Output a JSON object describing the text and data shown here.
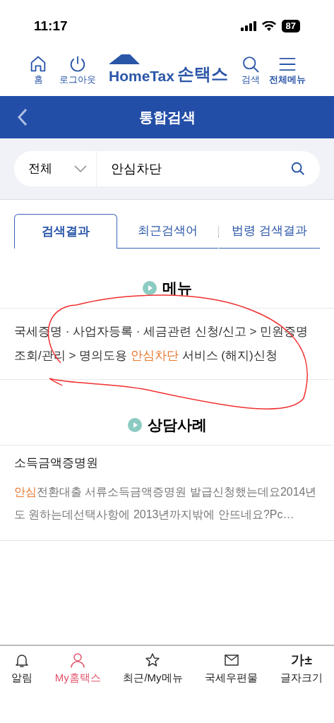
{
  "status_bar": {
    "time": "11:17",
    "battery": "87"
  },
  "header": {
    "left": [
      {
        "kind": "home",
        "label": "홈"
      },
      {
        "kind": "power",
        "label": "로그아웃"
      }
    ],
    "logo": {
      "latin": "HomeTax",
      "korean": "손택스"
    },
    "right": [
      {
        "kind": "search",
        "label": "검색",
        "bold": false
      },
      {
        "kind": "menu",
        "label": "전체메뉴",
        "bold": true
      }
    ]
  },
  "title_bar": {
    "title": "통합검색"
  },
  "search": {
    "category": "전체",
    "value": "안심차단"
  },
  "tabs": [
    {
      "label": "검색결과",
      "selected": true
    },
    {
      "label": "최근검색어",
      "selected": false
    },
    {
      "label": "법령 검색결과",
      "selected": false
    }
  ],
  "sections": [
    {
      "heading": "메뉴",
      "items": [
        {
          "segments": [
            {
              "text": "국세증명 · 사업자등록 · 세금관련 신청/신고 > 민원증명 조회/관리 > 명의도용 ",
              "highlight": false
            },
            {
              "text": "안심차단",
              "highlight": true
            },
            {
              "text": " 서비스 (해지)신청",
              "highlight": false
            }
          ]
        }
      ]
    },
    {
      "heading": "상담사례",
      "items": [
        {
          "title": "소득금액증명원",
          "segments": [
            {
              "text": "안심",
              "highlight": true
            },
            {
              "text": "전환대출 서류소득금액증명원 발급신청했는데요2014년도 원하는데선택사항에 2013년까지밖에 안뜨네요?Pc…",
              "highlight": false
            }
          ]
        }
      ]
    }
  ],
  "bottom_nav": [
    {
      "kind": "bell",
      "label": "알림",
      "selected": false
    },
    {
      "kind": "person",
      "label": "My홈택스",
      "selected": true
    },
    {
      "kind": "star",
      "label": "최근/My메뉴",
      "selected": false
    },
    {
      "kind": "mail",
      "label": "국세우편물",
      "selected": false
    },
    {
      "kind": "text",
      "icon_text": "가±",
      "label": "글자크기",
      "selected": false
    }
  ]
}
